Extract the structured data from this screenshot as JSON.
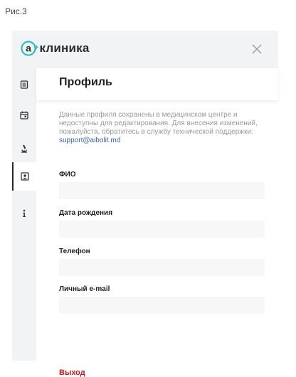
{
  "caption": "Рис.3",
  "app": {
    "logo_text": "клиника",
    "logo_plus": "+",
    "brand_color": "#27c1c4"
  },
  "sidebar": {
    "items": [
      {
        "icon": "document-list-icon",
        "active": false
      },
      {
        "icon": "calendar-icon",
        "active": false
      },
      {
        "icon": "microscope-icon",
        "active": false
      },
      {
        "icon": "profile-card-icon",
        "active": true
      },
      {
        "icon": "info-icon",
        "active": false
      }
    ]
  },
  "profile": {
    "title": "Профиль",
    "notice_text": "Данные профиля сохранены в медицинском центре и недоступны для редактирования. Для внесения изменений, пожалуйста, обратитесь в службу технической поддержки: ",
    "support_email": "support@aibolit.md",
    "fields": [
      {
        "label": "ФИО",
        "value": ""
      },
      {
        "label": "Дата рождения",
        "value": ""
      },
      {
        "label": "Телефон",
        "value": ""
      },
      {
        "label": "Личный e-mail",
        "value": ""
      }
    ],
    "logout_label": "Выход",
    "logout_color": "#d0121a"
  }
}
